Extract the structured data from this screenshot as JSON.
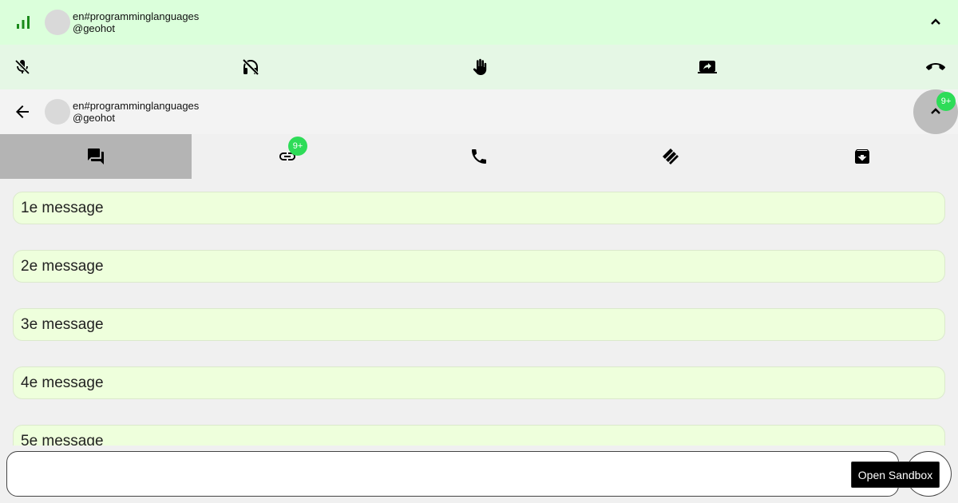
{
  "call_bar": {
    "channel": "en#programminglanguages",
    "user": "@geohot"
  },
  "chat_header": {
    "channel": "en#programminglanguages",
    "user": "@geohot",
    "fab_badge": "9+"
  },
  "tabs": [
    {
      "icon": "forum-icon",
      "badge": ""
    },
    {
      "icon": "link-icon",
      "badge": "9+"
    },
    {
      "icon": "phone-icon",
      "badge": ""
    },
    {
      "icon": "handshake-icon",
      "badge": ""
    },
    {
      "icon": "archive-icon",
      "badge": ""
    }
  ],
  "messages": [
    "1e message",
    "2e message",
    "3e message",
    "4e message",
    "5e message"
  ],
  "composer": {
    "placeholder": "",
    "sandbox_label": "Open Sandbox"
  },
  "colors": {
    "call_bar": "#dbffdb",
    "controls_bar": "#e5f7e5",
    "message_bg": "#eeffdc",
    "badge": "#2edc58",
    "signal": "#1a8a1a"
  }
}
